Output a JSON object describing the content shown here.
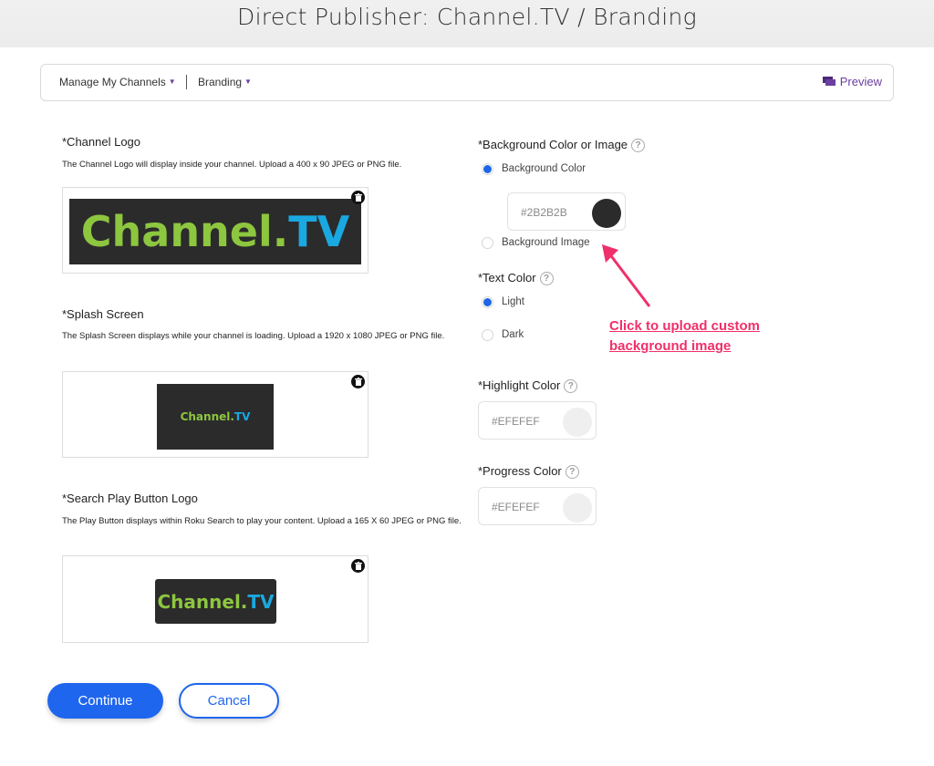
{
  "page_title": "Direct Publisher: Channel.TV / Branding",
  "nav": {
    "manage_channels": "Manage My Channels",
    "branding": "Branding",
    "preview": "Preview"
  },
  "channel_logo": {
    "label": "*Channel Logo",
    "description": "The Channel Logo will display inside your channel. Upload a 400 x 90 JPEG or PNG file.",
    "logo_part1": "Channel.",
    "logo_part2": "TV"
  },
  "splash_screen": {
    "label": "*Splash Screen",
    "description": "The Splash Screen displays while your channel is loading. Upload a 1920 x 1080 JPEG or PNG file.",
    "logo_part1": "Channel.",
    "logo_part2": "TV"
  },
  "search_play_button": {
    "label": "*Search Play Button Logo",
    "description": "The Play Button displays within Roku Search to play your content. Upload a 165 X 60 JPEG or PNG file.",
    "logo_part1": "Channel.",
    "logo_part2": "TV"
  },
  "background": {
    "label": "*Background Color or Image",
    "options": [
      {
        "label": "Background Color",
        "selected": true
      },
      {
        "label": "Background Image",
        "selected": false
      }
    ],
    "color_value": "#2B2B2B",
    "swatch_color": "#2b2b2b"
  },
  "text_color": {
    "label": "*Text Color",
    "options": [
      {
        "label": "Light",
        "selected": true
      },
      {
        "label": "Dark",
        "selected": false
      }
    ]
  },
  "highlight_color": {
    "label": "*Highlight Color",
    "value": "#EFEFEF",
    "swatch_color": "#efefef"
  },
  "progress_color": {
    "label": "*Progress Color",
    "value": "#EFEFEF",
    "swatch_color": "#efefef"
  },
  "annotation": {
    "line1": "Click to upload custom",
    "line2": "background image",
    "color": "#f0306b"
  },
  "actions": {
    "continue": "Continue",
    "cancel": "Cancel"
  },
  "help_glyph": "?"
}
